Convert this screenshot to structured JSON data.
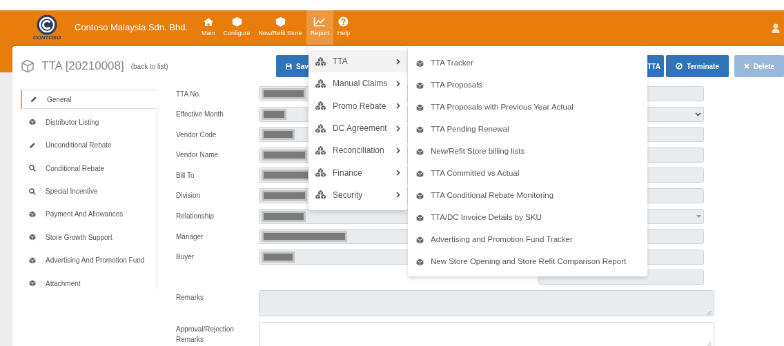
{
  "header": {
    "logo_text": "CONTOSO",
    "company": "Contoso Malaysia Sdn. Bhd.",
    "nav": [
      {
        "label": "Main",
        "kind": "home",
        "selected": false
      },
      {
        "label": "Configure",
        "kind": "cube",
        "selected": false
      },
      {
        "label": "New/Refit Store",
        "kind": "cube",
        "selected": false
      },
      {
        "label": "Report",
        "kind": "chart",
        "selected": true
      },
      {
        "label": "Help",
        "kind": "help",
        "selected": false
      }
    ]
  },
  "page": {
    "title": "TTA [20210008]",
    "back_link": "(back to list)"
  },
  "buttons": [
    {
      "label": "Sav",
      "kind": "save",
      "disabled": false
    },
    {
      "label": "TTA",
      "kind": "plain",
      "disabled": false
    },
    {
      "label": "Terminate",
      "kind": "terminate",
      "disabled": false
    },
    {
      "label": "Delete",
      "kind": "delete",
      "disabled": true
    }
  ],
  "sidebar": {
    "items": [
      {
        "label": "General",
        "kind": "pencil",
        "selected": true
      },
      {
        "label": "Distributor Listing",
        "kind": "cube",
        "selected": false
      },
      {
        "label": "Unconditional Rebate",
        "kind": "pencil",
        "selected": false
      },
      {
        "label": "Conditional Rebate",
        "kind": "search",
        "selected": false
      },
      {
        "label": "Special Incentive",
        "kind": "search",
        "selected": false
      },
      {
        "label": "Payment And Allowances",
        "kind": "cube",
        "selected": false
      },
      {
        "label": "Store Growth Support",
        "kind": "cube",
        "selected": false
      },
      {
        "label": "Advertising And Promotion Fund",
        "kind": "cube",
        "selected": false
      },
      {
        "label": "Attachment",
        "kind": "cube",
        "selected": false
      }
    ]
  },
  "form": {
    "fields": [
      {
        "label": "TTA No.",
        "kind": "text",
        "disabled": true
      },
      {
        "label": "Effective Month",
        "kind": "select",
        "disabled": true
      },
      {
        "label": "Vendor Code",
        "kind": "text",
        "disabled": true
      },
      {
        "label": "Vendor Name",
        "kind": "text",
        "disabled": true
      },
      {
        "label": "Bill To",
        "kind": "text",
        "disabled": true
      },
      {
        "label": "Division",
        "kind": "text",
        "disabled": true
      },
      {
        "label": "Relationship",
        "kind": "dropdown",
        "disabled": true
      },
      {
        "label": "Manager",
        "kind": "text",
        "disabled": true
      },
      {
        "label": "Buyer",
        "kind": "text",
        "disabled": true
      },
      {
        "kind": "short",
        "disabled": true
      },
      {
        "label": "Remarks",
        "kind": "textarea",
        "disabled": true
      },
      {
        "label": "Approval/Rejection Remarks",
        "kind": "textarea",
        "disabled": false
      }
    ]
  },
  "report_menu": {
    "items": [
      {
        "label": "TTA",
        "selected": true
      },
      {
        "label": "Manual Claims",
        "selected": false
      },
      {
        "label": "Promo Rebate",
        "selected": false
      },
      {
        "label": "DC Agreement",
        "selected": false
      },
      {
        "label": "Reconciliation",
        "selected": false
      },
      {
        "label": "Finance",
        "selected": false
      },
      {
        "label": "Security",
        "selected": false
      }
    ]
  },
  "submenu": {
    "items": [
      "TTA Tracker",
      "TTA Proposals",
      "TTA Proposals with Previous Year Actual",
      "TTA Pending Renewal",
      "New/Refit Store billing lists",
      "TTA Committed vs Actual",
      "TTA Conditional Rebate Monitoring",
      "TTA/DC Invoice Details by SKU",
      "Advertising and Promotion Fund Tracker",
      "New Store Opening and Store Refit Comparison Report"
    ]
  }
}
